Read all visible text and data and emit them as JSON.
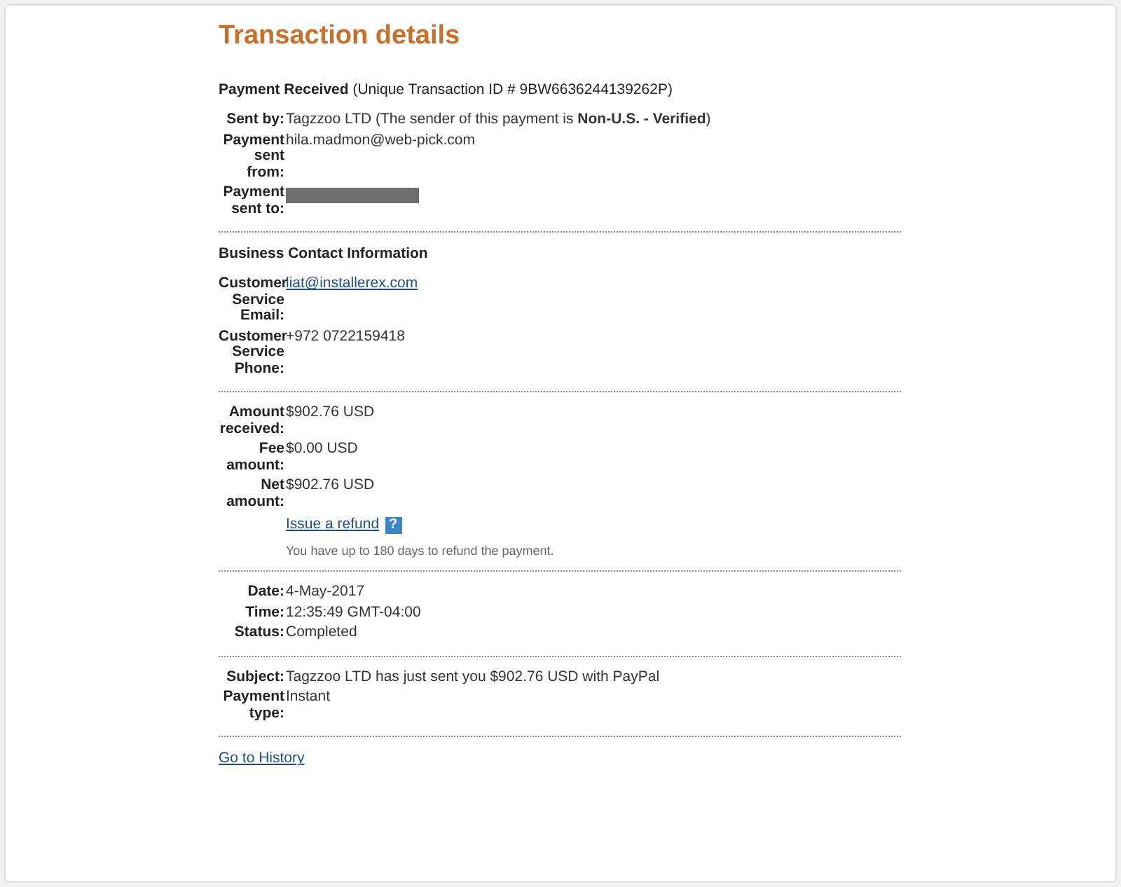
{
  "title": "Transaction details",
  "sections": [
    {
      "heading": "**Payment Received** (Unique Transaction ID # 9BW6636244139262P)",
      "rows": [
        {
          "label": "Sent by:",
          "value": "Tagzzoo LTD (The sender of this payment is **Non-U.S. - Verified**)",
          "kind": "text"
        },
        {
          "label": "Payment sent from:",
          "value": "hila.madmon@web-pick.com",
          "kind": "text"
        },
        {
          "label": "Payment sent to:",
          "kind": "redacted"
        }
      ]
    },
    {
      "heading": "**Business Contact Information**",
      "rows": [
        {
          "label": "Customer Service Email:",
          "value": "liat@installerex.com",
          "kind": "link"
        },
        {
          "label": "Customer Service Phone:",
          "value": "+972 0722159418",
          "kind": "text"
        }
      ]
    },
    {
      "rows": [
        {
          "label": "Amount received:",
          "value": "$902.76 USD",
          "kind": "text"
        },
        {
          "label": "Fee amount:",
          "value": "$0.00 USD",
          "kind": "text"
        },
        {
          "label": "Net amount:",
          "value": "$902.76 USD",
          "kind": "text"
        }
      ],
      "refund": {
        "link": "Issue a refund",
        "help": "?",
        "note": "You have up to 180 days to refund the payment."
      }
    },
    {
      "rows": [
        {
          "label": "Date:",
          "value": "4-May-2017",
          "kind": "text"
        },
        {
          "label": "Time:",
          "value": "12:35:49 GMT-04:00",
          "kind": "text"
        },
        {
          "label": "Status:",
          "value": "Completed",
          "kind": "text"
        }
      ]
    },
    {
      "rows": [
        {
          "label": "Subject:",
          "value": "Tagzzoo LTD has just sent you $902.76 USD with PayPal",
          "kind": "text"
        },
        {
          "label": "Payment type:",
          "value": "Instant",
          "kind": "text"
        }
      ]
    }
  ],
  "footer_link": "Go to History"
}
